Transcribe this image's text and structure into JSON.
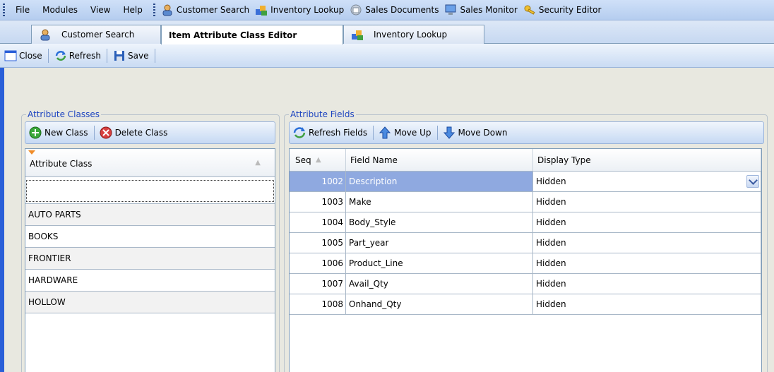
{
  "menu": {
    "items": [
      {
        "label": "File",
        "mnemonic": "F"
      },
      {
        "label": "Modules",
        "mnemonic": "M"
      },
      {
        "label": "View",
        "mnemonic": "V"
      },
      {
        "label": "Help",
        "mnemonic": "H"
      }
    ],
    "tools": [
      {
        "label": "Customer Search",
        "icon": "customer-icon"
      },
      {
        "label": "Inventory Lookup",
        "icon": "inventory-icon"
      },
      {
        "label": "Sales Documents",
        "icon": "documents-icon"
      },
      {
        "label": "Sales Monitor",
        "icon": "monitor-icon"
      },
      {
        "label": "Security Editor",
        "icon": "key-icon"
      }
    ]
  },
  "tabs": [
    {
      "label": "Customer Search",
      "active": false
    },
    {
      "label": "Item Attribute Class Editor",
      "active": true
    },
    {
      "label": "Inventory Lookup",
      "active": false
    }
  ],
  "toolbar": {
    "close_label": "Close",
    "refresh_label": "Refresh",
    "save_label": "Save"
  },
  "attribute_classes": {
    "title": "Attribute Classes",
    "new_label": "New Class",
    "delete_label": "Delete Class",
    "column_header": "Attribute Class",
    "filter_value": "",
    "rows": [
      "AUTO PARTS",
      "BOOKS",
      "FRONTIER",
      "HARDWARE",
      "HOLLOW"
    ]
  },
  "attribute_fields": {
    "title": "Attribute Fields",
    "refresh_label": "Refresh Fields",
    "move_up_label": "Move Up",
    "move_down_label": "Move Down",
    "headers": {
      "seq": "Seq",
      "name": "Field Name",
      "type": "Display Type"
    },
    "rows": [
      {
        "seq": "1002",
        "name": "Description",
        "type": "Hidden"
      },
      {
        "seq": "1003",
        "name": "Make",
        "type": "Hidden"
      },
      {
        "seq": "1004",
        "name": "Body_Style",
        "type": "Hidden"
      },
      {
        "seq": "1005",
        "name": "Part_year",
        "type": "Hidden"
      },
      {
        "seq": "1006",
        "name": "Product_Line",
        "type": "Hidden"
      },
      {
        "seq": "1007",
        "name": "Avail_Qty",
        "type": "Hidden"
      },
      {
        "seq": "1008",
        "name": "Onhand_Qty",
        "type": "Hidden"
      }
    ]
  },
  "colors": {
    "accent": "#1e45c0",
    "selection": "#8fa9e0",
    "edge": "#2a5fd8"
  }
}
